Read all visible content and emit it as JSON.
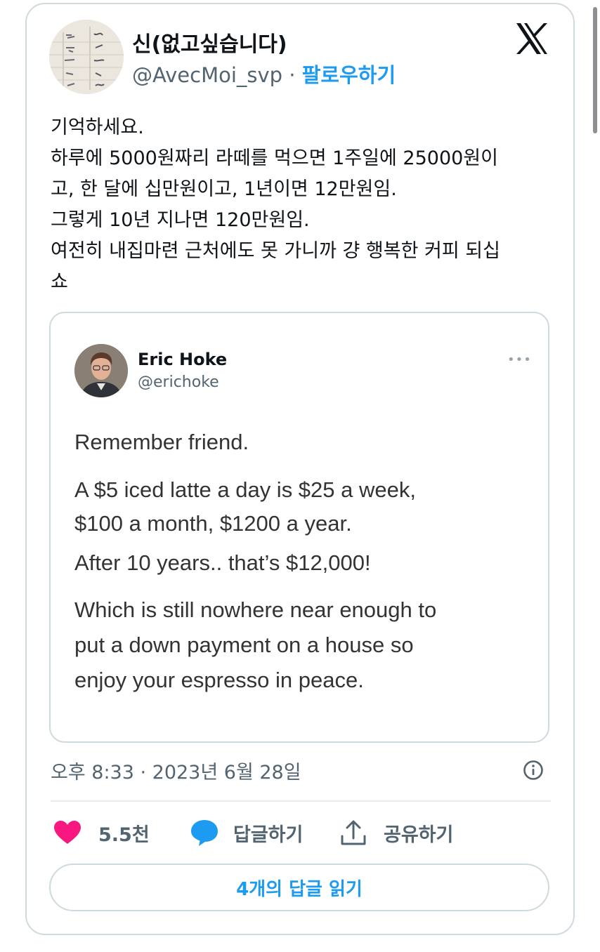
{
  "author": {
    "name": "신(없고싶습니다)",
    "handle": "@AvecMoi_svp",
    "separator": " · ",
    "follow_label": "팔로우하기"
  },
  "tweet_lines": [
    "기억하세요.",
    "하루에 5000원짜리 라떼를 먹으면 1주일에 25000원이",
    "고, 한 달에 십만원이고, 1년이면 12만원임.",
    "그렇게 10년 지나면 120만원임.",
    "여전히 내집마련 근처에도 못 가니까 걍 행복한 커피 되십",
    "쇼"
  ],
  "quote": {
    "name": "Eric Hoke",
    "handle": "@erichoke",
    "more": "•••",
    "p1": "Remember friend.",
    "p2": [
      "A $5 iced latte a day is $25 a week,",
      "$100 a month, $1200 a year."
    ],
    "p3": "After 10 years.. that’s $12,000!",
    "p4": [
      "Which is still nowhere near enough to",
      "put a down payment on a house so",
      "enjoy your espresso in peace."
    ]
  },
  "timestamp": "오후 8:33 · 2023년 6월 28일",
  "actions": {
    "like_count": "5.5천",
    "reply_label": "답글하기",
    "share_label": "공유하기"
  },
  "read_replies": "4개의 답글 읽기",
  "colors": {
    "accent": "#1d9bf0",
    "like": "#f91880",
    "border": "#cfd9de",
    "muted": "#536471"
  },
  "icons": [
    "x-logo-icon",
    "info-icon",
    "heart-icon",
    "speech-bubble-icon",
    "share-icon"
  ]
}
